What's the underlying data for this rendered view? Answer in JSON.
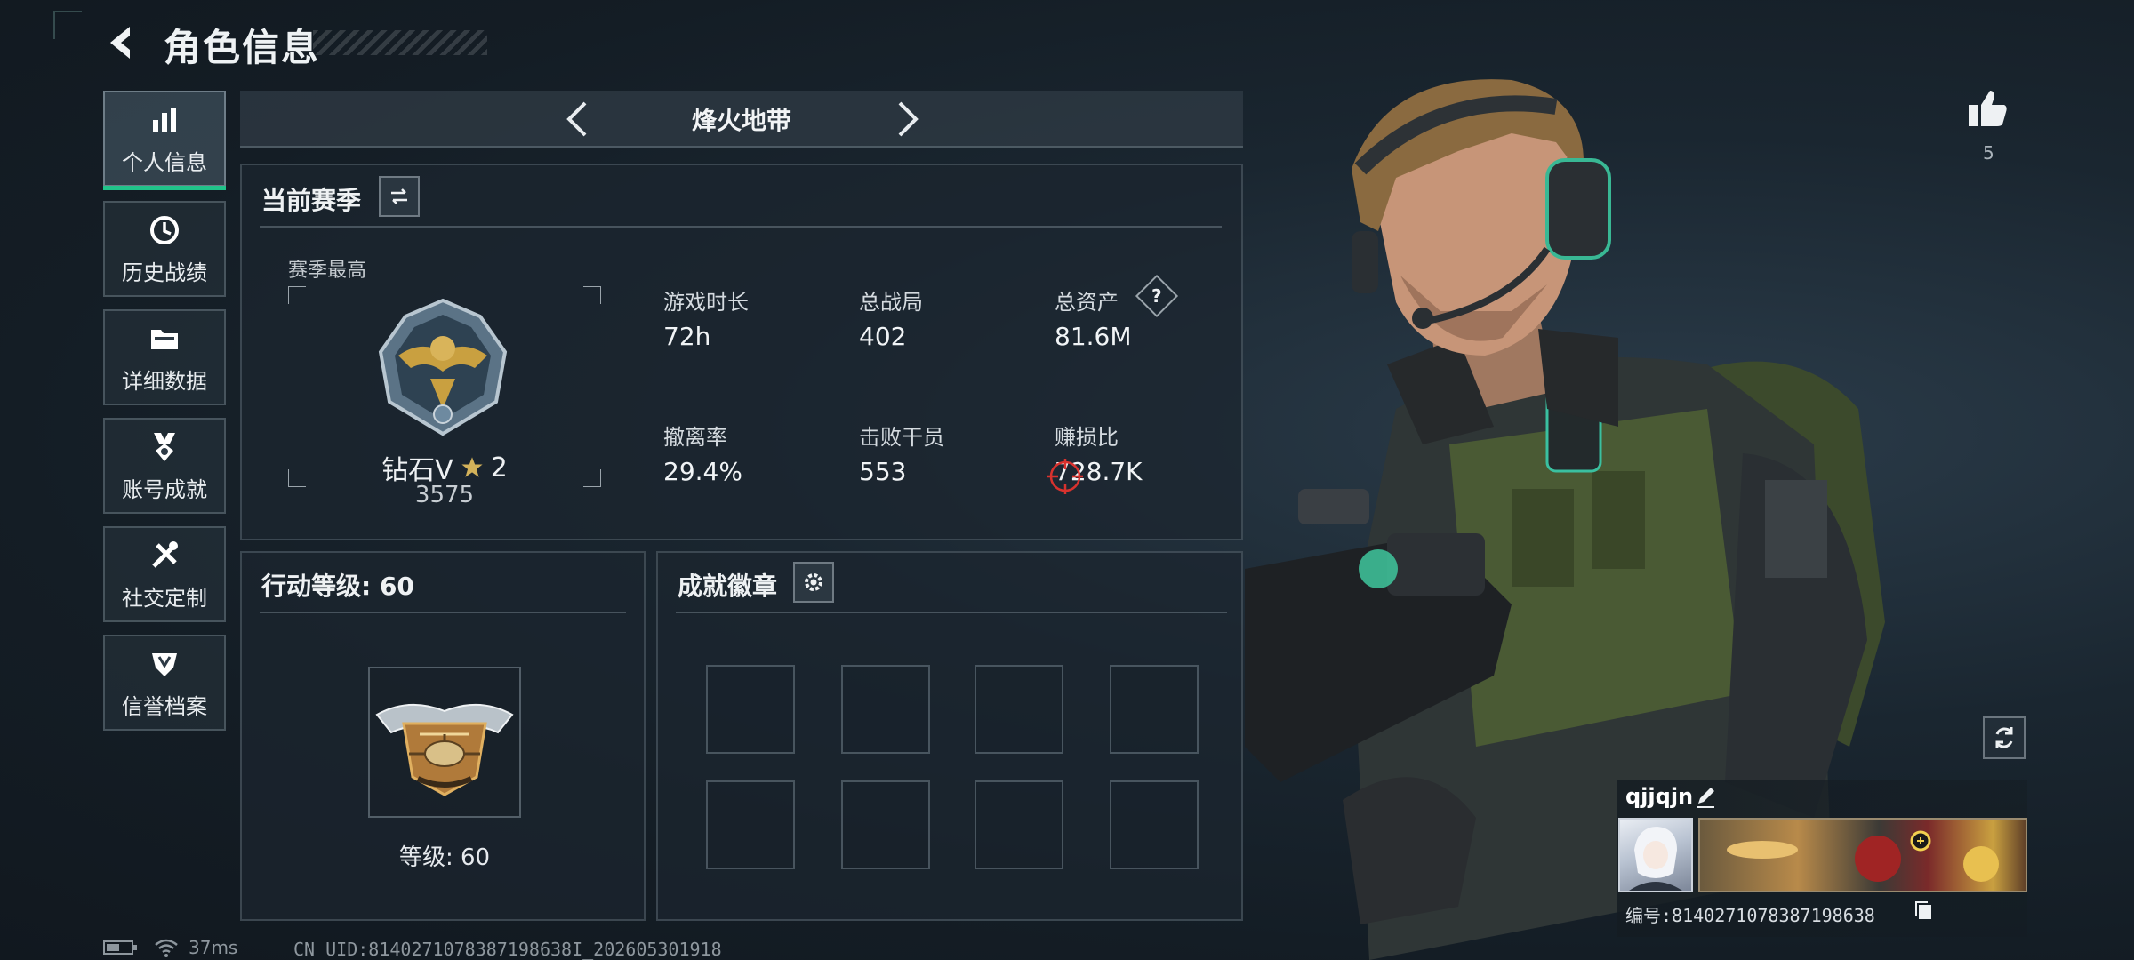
{
  "header": {
    "title": "角色信息"
  },
  "sidebar": {
    "items": [
      {
        "label": "个人信息",
        "icon": "bar-chart-icon",
        "active": true
      },
      {
        "label": "历史战绩",
        "icon": "history-clock-icon",
        "active": false
      },
      {
        "label": "详细数据",
        "icon": "folder-icon",
        "active": false
      },
      {
        "label": "账号成就",
        "icon": "medal-icon",
        "active": false
      },
      {
        "label": "社交定制",
        "icon": "tools-icon",
        "active": false
      },
      {
        "label": "信誉档案",
        "icon": "shield-icon",
        "active": false
      }
    ]
  },
  "mode": {
    "label": "烽火地带"
  },
  "season": {
    "title": "当前赛季",
    "best_label": "赛季最高",
    "rank_name": "钻石V",
    "rank_stars": "2",
    "rank_score": "3575",
    "stats": [
      {
        "label": "游戏时长",
        "value": "72h"
      },
      {
        "label": "总战局",
        "value": "402"
      },
      {
        "label": "总资产",
        "value": "81.6M",
        "help": "?"
      },
      {
        "label": "撤离率",
        "value": "29.4%"
      },
      {
        "label": "击败干员",
        "value": "553"
      },
      {
        "label": "赚损比",
        "value": "728.7K"
      }
    ]
  },
  "level": {
    "title": "行动等级: 60",
    "caption": "等级: 60"
  },
  "badges": {
    "title": "成就徽章",
    "slot_count": 8
  },
  "likes": {
    "count": "5"
  },
  "profile": {
    "name": "qjjqjn",
    "id_text": "编号:8140271078387198638"
  },
  "status": {
    "ping": "37ms",
    "uid": "CN UID:8140271078387198638I_202605301918"
  },
  "colors": {
    "accent": "#21c48a",
    "panel": "#1c262f",
    "gold": "#c9a040"
  }
}
